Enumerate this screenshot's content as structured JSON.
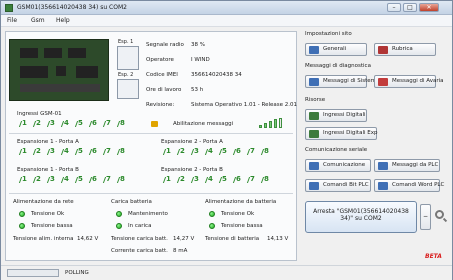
{
  "window": {
    "title": "GSM01(356614020438 34) su COM2",
    "title_exact": "GSM01(356614020438​34) su COM2"
  },
  "menu": [
    "File",
    "Gsm",
    "Help"
  ],
  "esp": {
    "e1": "Esp. 1",
    "e2": "Esp. 2"
  },
  "device_info": {
    "signal_label": "Segnale radio",
    "signal_value": "38 %",
    "operator_label": "Operatore",
    "operator_value": "I WIND",
    "imei_label": "Codice IMEI",
    "imei_value": "356614020438 34",
    "hours_label": "Ore di lavoro",
    "hours_value": "53 h",
    "rev_label": "Revisione:",
    "rev_value": "Sistema Operativo 1.01 - Release 2.01"
  },
  "inputs": {
    "title": "Ingressi GSM-01",
    "enable_label": "Abilitazione messaggi",
    "nums": [
      "1",
      "2",
      "3",
      "4",
      "5",
      "6",
      "7",
      "8"
    ]
  },
  "expansions": {
    "e1a": "Espansione 1 - Porta A",
    "e2a": "Espansione 2 - Porta A",
    "e1b": "Espansione 1 - Porta B",
    "e2b": "Espansione 2 - Porta B"
  },
  "power": {
    "net_title": "Alimentazione da rete",
    "net_ok": "Tensione Ok",
    "net_low": "Tensione bassa",
    "net_int_label": "Tensione alim. interna",
    "net_int_value": "14,62 V",
    "charge_title": "Carica batteria",
    "charge_maint": "Mantenimento",
    "charge_in": "In carica",
    "charge_volt_label": "Tensione carica batt.",
    "charge_volt_value": "14,27 V",
    "charge_curr_label": "Corrente carica batt.",
    "charge_curr_value": "8 mA",
    "batt_title": "Alimentazione da batteria",
    "batt_ok": "Tensione Ok",
    "batt_low": "Tensione bassa",
    "batt_volt_label": "Tensione di batteria",
    "batt_volt_value": "14,13 V"
  },
  "right": {
    "site_title": "Impostazioni sito",
    "generali": "Generali",
    "rubrica": "Rubrica",
    "diag_title": "Messaggi di diagnostica",
    "msg_sistema": "Messaggi di Sistema",
    "msg_avaria": "Messaggi di Avaria",
    "risorse_title": "Risorse",
    "ingressi_digitali": "Ingressi Digitali",
    "ingressi_exp": "Ingressi Digitali Exp",
    "com_title": "Comunicazione seriale",
    "comunicazione": "Comunicazione",
    "msg_plc": "Messaggi da PLC",
    "cmd_bit": "Comandi Bit PLC",
    "cmd_word": "Comandi Word PLC",
    "stop_btn": "Arresta \"GSM01(356614020438 34)\" su COM2",
    "small_btn_1": "<",
    "small_btn_2": "−"
  },
  "status": {
    "text": "POLLING",
    "beta": "BETA",
    "progress_pct": 0
  },
  "colors": {
    "accent_green": "#2c8a2c",
    "led_green": "#1ba61b",
    "beta": "#d91f1f"
  }
}
